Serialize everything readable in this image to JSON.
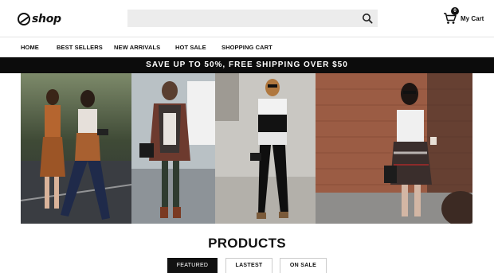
{
  "header": {
    "logo_text": "shop",
    "search": {
      "placeholder": "",
      "value": ""
    },
    "cart": {
      "count": "0",
      "label": "My Cart"
    }
  },
  "nav": {
    "items": [
      {
        "label": "HOME"
      },
      {
        "label": "BEST SELLERS"
      },
      {
        "label": "NEW ARRIVALS"
      },
      {
        "label": "HOT SALE"
      },
      {
        "label": "SHOPPING CART"
      }
    ]
  },
  "promo": {
    "text": "SAVE UP TO 50%, FREE SHIPPING OVER $50"
  },
  "products": {
    "title": "PRODUCTS",
    "tabs": [
      {
        "label": "FEATURED",
        "active": true
      },
      {
        "label": "LASTEST",
        "active": false
      },
      {
        "label": "ON SALE",
        "active": false
      }
    ]
  },
  "icons": {
    "search": "search-icon",
    "cart": "cart-icon",
    "logo": "logo-icon"
  }
}
